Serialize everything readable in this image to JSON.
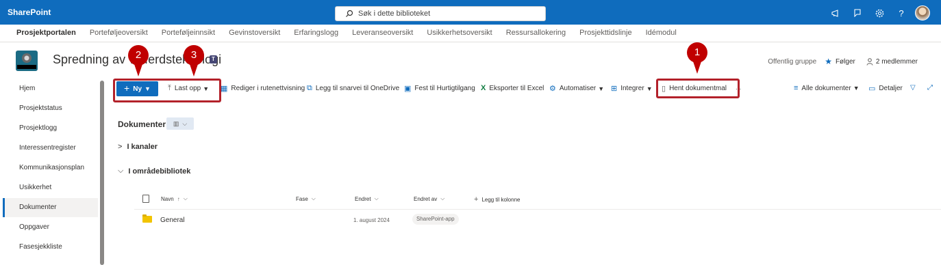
{
  "suitebar": {
    "brand": "SharePoint",
    "search_placeholder": "Søk i dette biblioteket",
    "icons": [
      "megaphone-icon",
      "feedback-icon",
      "settings-icon",
      "help-icon"
    ],
    "help_glyph": "?"
  },
  "hubnav": {
    "home": "Prosjektportalen",
    "items": [
      "Porteføljeoversikt",
      "Porteføljeinnsikt",
      "Gevinstoversikt",
      "Erfaringslogg",
      "Leveranseoversikt",
      "Usikkerhetsoversikt",
      "Ressursallokering",
      "Prosjekttidslinje",
      "Idémodul"
    ]
  },
  "site": {
    "title": "Spredning av velferdsteknologi",
    "group_type": "Offentlig gruppe",
    "follow": "Følger",
    "members": "2 medlemmer"
  },
  "leftnav": {
    "items": [
      "Hjem",
      "Prosjektstatus",
      "Prosjektlogg",
      "Interessentregister",
      "Kommunikasjonsplan",
      "Usikkerhet",
      "Dokumenter",
      "Oppgaver",
      "Fasesjekkliste"
    ],
    "selected": "Dokumenter"
  },
  "commandbar": {
    "new": "Ny",
    "upload": "Last opp",
    "edit_grid": "Rediger i rutenettvisning",
    "add_shortcut": "Legg til snarvei til OneDrive",
    "pin": "Fest til Hurtigtilgang",
    "export": "Eksporter til Excel",
    "automate": "Automatiser",
    "integrate": "Integrer",
    "get_template": "Hent dokumentmal",
    "more": "...",
    "view": "Alle dokumenter",
    "details": "Detaljer"
  },
  "library": {
    "title": "Dokumenter",
    "groups": [
      "I kanaler",
      "I områdebibliotek"
    ],
    "columns": {
      "name": "Navn",
      "phase": "Fase",
      "modified": "Endret",
      "modified_by": "Endret av",
      "add_column": "Legg til kolonne"
    },
    "rows": [
      {
        "name": "General",
        "modified": "1. august 2024",
        "modified_by": "SharePoint-app"
      }
    ]
  },
  "annotations": {
    "labels": [
      "1",
      "2",
      "3"
    ],
    "color": "#c00000"
  },
  "colors": {
    "brand": "#0f6cbd",
    "annotation": "#c00000"
  }
}
